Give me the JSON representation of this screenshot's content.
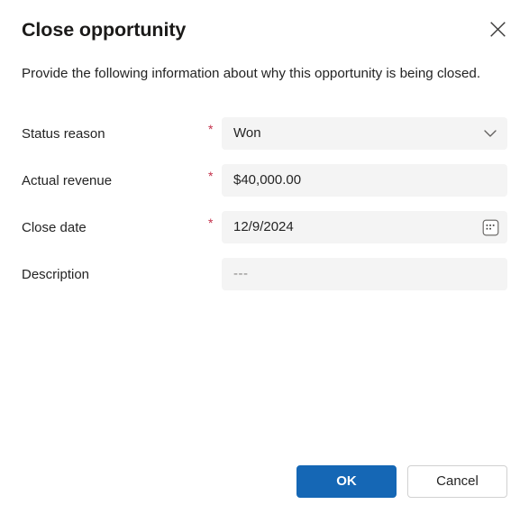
{
  "dialog": {
    "title": "Close opportunity",
    "subtitle": "Provide the following information about why this opportunity is being closed.",
    "close_icon": "close-icon",
    "required_mark": "*"
  },
  "form": {
    "fields": [
      {
        "label": "Status reason",
        "required": true,
        "value": "Won",
        "placeholder": "",
        "control": "dropdown",
        "icon": "chevron-down-icon"
      },
      {
        "label": "Actual revenue",
        "required": true,
        "value": "$40,000.00",
        "placeholder": "",
        "control": "text",
        "icon": ""
      },
      {
        "label": "Close date",
        "required": true,
        "value": "12/9/2024",
        "placeholder": "",
        "control": "date",
        "icon": "calendar-icon"
      },
      {
        "label": "Description",
        "required": false,
        "value": "",
        "placeholder": "---",
        "control": "text",
        "icon": ""
      }
    ]
  },
  "footer": {
    "ok_label": "OK",
    "cancel_label": "Cancel"
  },
  "colors": {
    "accent": "#1567b5",
    "required": "#c4314b",
    "field_background": "#f4f4f4",
    "text": "#242424",
    "placeholder": "#8a8886"
  }
}
